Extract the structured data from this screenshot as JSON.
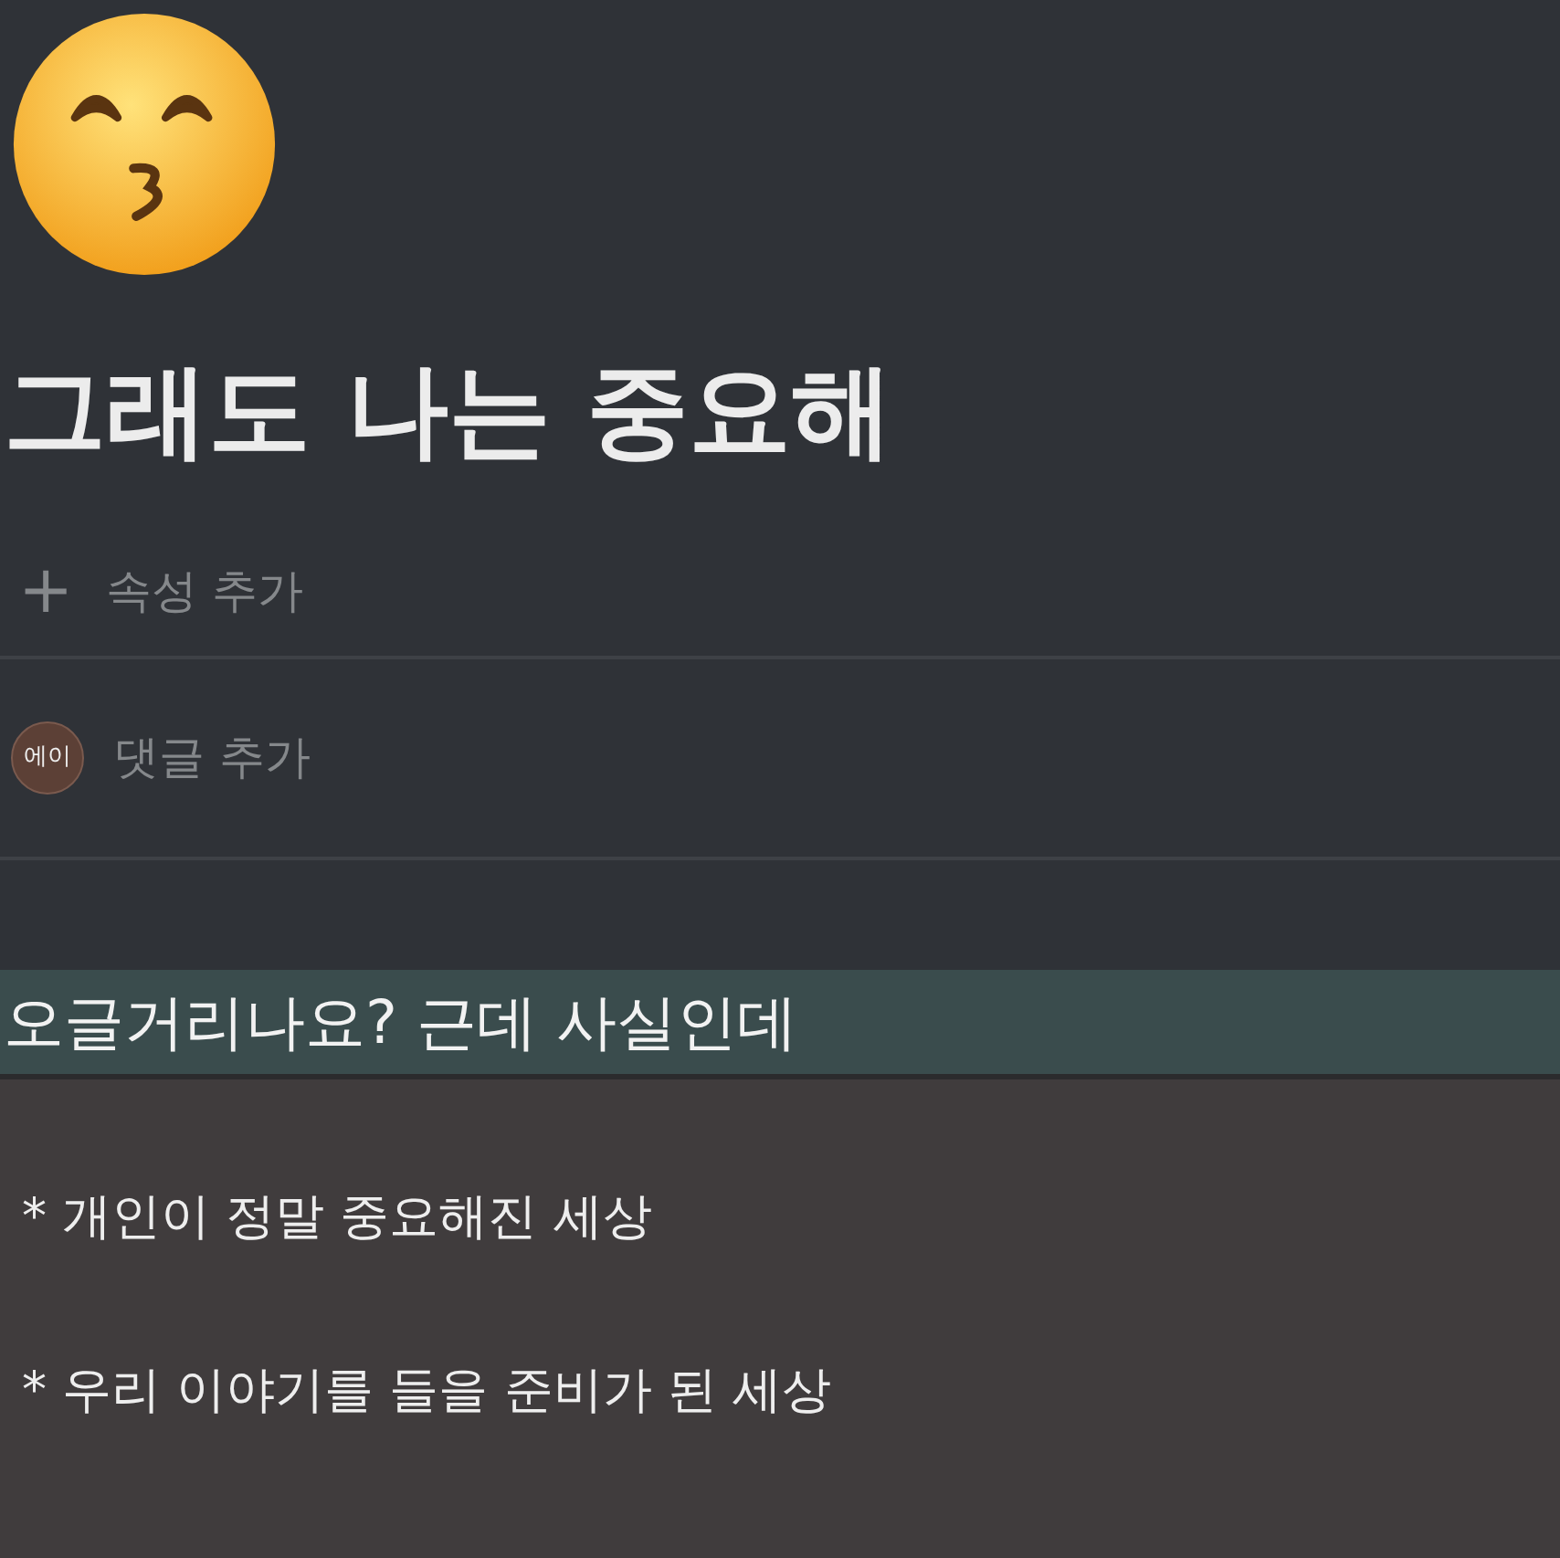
{
  "title": "그래도 나는 중요해",
  "add_property": {
    "icon": "+",
    "label": "속성 추가"
  },
  "comment": {
    "avatar": "에이",
    "placeholder": "댓글 추가"
  },
  "callout": {
    "heading": "오글거리나요? 근데 사실인데",
    "lines": [
      "* 개인이 정말 중요해진 세상",
      "* 우리 이야기를 들을 준비가 된 세상"
    ]
  }
}
